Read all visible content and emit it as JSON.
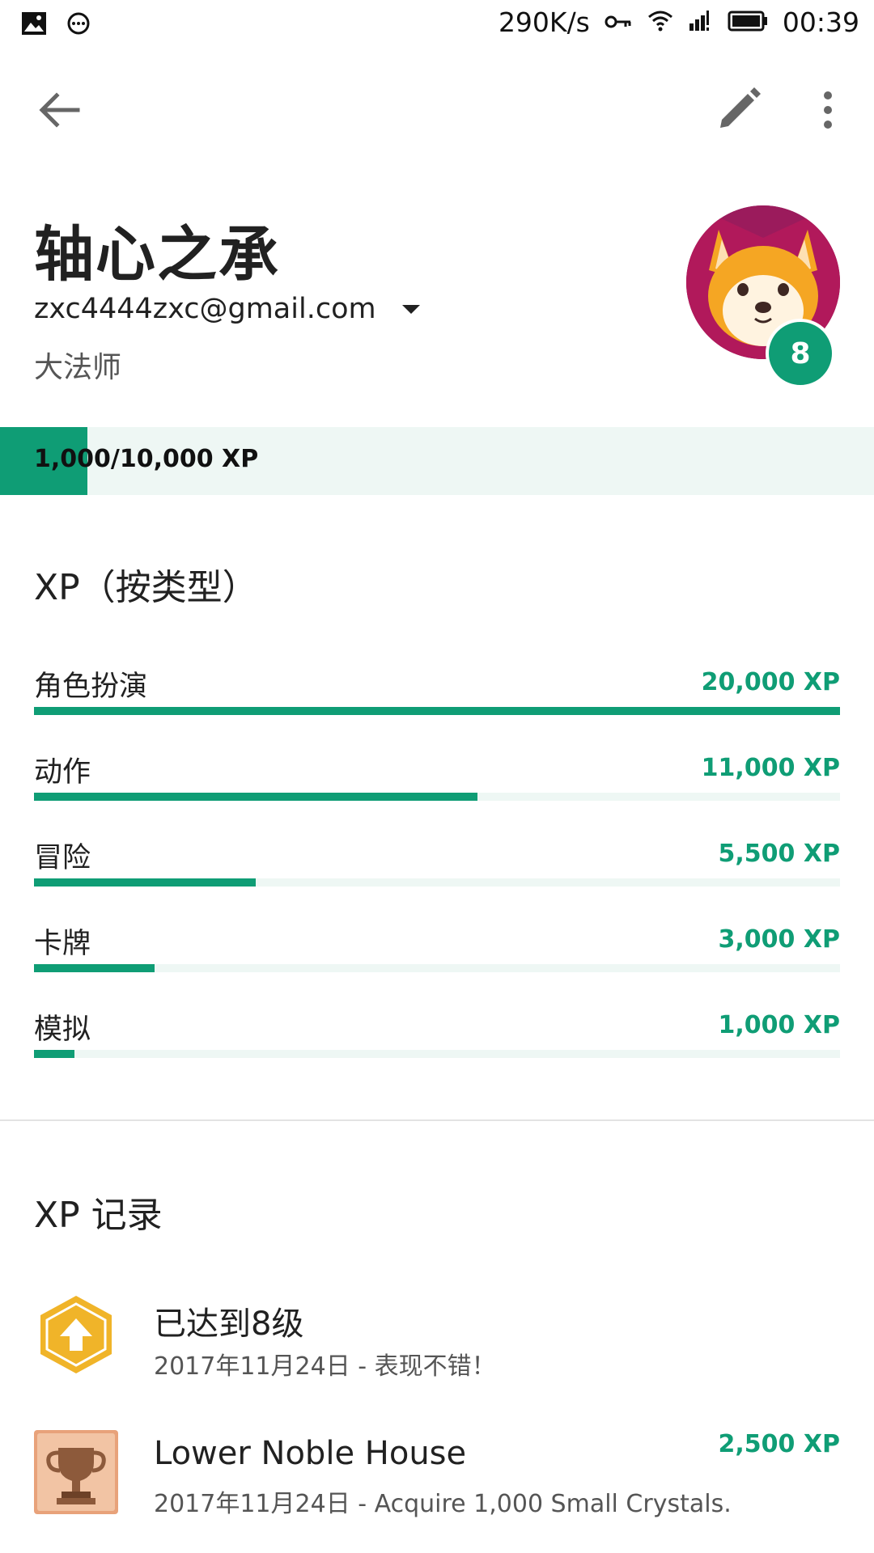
{
  "status_bar": {
    "network_speed": "290K/s",
    "time": "00:39",
    "icons": [
      "image-icon",
      "chat-icon",
      "key-icon",
      "wifi-icon",
      "signal-icon",
      "battery-icon"
    ]
  },
  "app_bar": {
    "back_icon": "arrow-back-icon",
    "edit_icon": "pencil-icon",
    "more_icon": "more-vert-icon"
  },
  "profile": {
    "name": "轴心之承",
    "email": "zxc4444zxc@gmail.com",
    "title": "大法师",
    "level": "8"
  },
  "xp_progress": {
    "text": "1,000/10,000 XP",
    "current": 1000,
    "total": 10000
  },
  "xp_by_type": {
    "title": "XP（按类型）",
    "items": [
      {
        "label": "角色扮演",
        "value": "20,000 XP",
        "amount": 20000
      },
      {
        "label": "动作",
        "value": "11,000 XP",
        "amount": 11000
      },
      {
        "label": "冒险",
        "value": "5,500 XP",
        "amount": 5500
      },
      {
        "label": "卡牌",
        "value": "3,000 XP",
        "amount": 3000
      },
      {
        "label": "模拟",
        "value": "1,000 XP",
        "amount": 1000
      }
    ]
  },
  "xp_history": {
    "title": "XP 记录",
    "items": [
      {
        "title": "已达到8级",
        "subtitle": "2017年11月24日 - 表现不错！",
        "xp": "",
        "icon": "level-up-hexagon-icon"
      },
      {
        "title": "Lower Noble House",
        "subtitle": "2017年11月24日 - Acquire 1,000 Small Crystals.",
        "xp": "2,500 XP",
        "icon": "trophy-icon"
      }
    ]
  },
  "colors": {
    "accent": "#0f9d75",
    "track": "#eef7f4",
    "avatar_bg": "#9b1b5c",
    "hexagon": "#f0b429"
  }
}
